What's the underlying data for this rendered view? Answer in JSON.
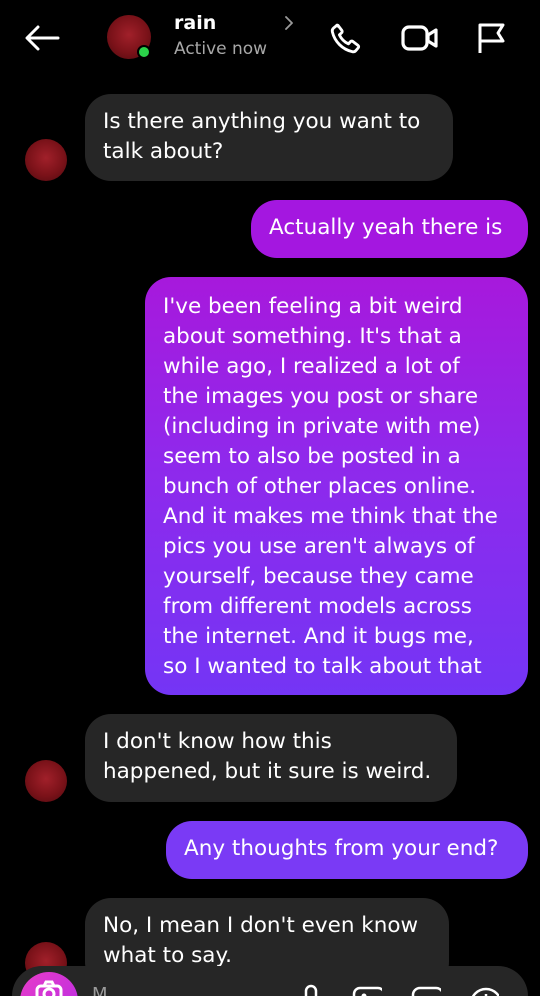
{
  "header": {
    "contact_name": "rain",
    "status": "Active now",
    "icons": [
      "back-arrow-icon",
      "chevron-right-icon",
      "phone-icon",
      "video-icon",
      "flag-icon"
    ]
  },
  "messages": [
    {
      "direction": "incoming",
      "lines": [
        "Is there anything you want to",
        "talk about?"
      ]
    },
    {
      "direction": "outgoing",
      "lines": [
        "Actually yeah there is"
      ]
    },
    {
      "direction": "outgoing",
      "lines": [
        "I've been feeling a bit weird",
        "about something. It's that a",
        "while ago, I realized a lot of",
        "the images you post or share",
        "(including in private with me)",
        "seem to also be posted in a",
        "bunch of other places online.",
        "And it makes me think that the",
        "pics you use aren't always of",
        "yourself, because they came",
        "from different models across",
        "the internet. And it bugs me,",
        "so I wanted to talk about that"
      ]
    },
    {
      "direction": "incoming",
      "lines": [
        "I don't know how this",
        "happened, but it sure is weird."
      ]
    },
    {
      "direction": "outgoing",
      "lines": [
        "Any thoughts from your end?"
      ]
    },
    {
      "direction": "incoming",
      "lines": [
        "No, I mean I don't even know",
        "what to say."
      ]
    }
  ],
  "composer": {
    "placeholder": "M",
    "icons": [
      "camera-icon",
      "microphone-icon",
      "image-icon",
      "sticker-icon",
      "add-icon"
    ]
  },
  "colors": {
    "background": "#000000",
    "incoming_bubble": "#262626",
    "outgoing_pink": "#a417e0",
    "outgoing_violet": "#7a3af5",
    "online": "#2bd24a",
    "avatar_red": "#8b1620"
  }
}
